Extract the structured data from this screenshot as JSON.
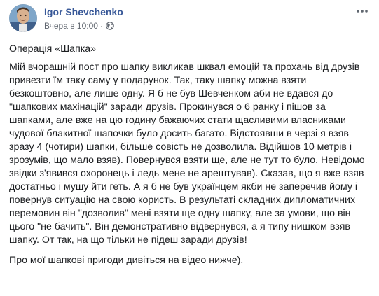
{
  "post": {
    "author": "Igor Shevchenko",
    "timestamp": "Вчера в 10:00",
    "separator": "·",
    "privacy_icon": "globe-icon",
    "more_icon": "more-options-icon",
    "title": "Операція «Шапка»",
    "body": "Мій вчорашній пост про шапку викликав шквал емоцій та прохань від друзів привезти їм таку саму у подарунок. Так, таку шапку можна взяти безкоштовно, але лише одну. Я б не був Шевченком аби не вдався до \"шапкових махінацій\" заради друзів. Прокинувся о 6 ранку і пішов за шапками, але вже на цю годину бажаючих стати щасливими власниками чудової блакитної шапочки було досить багато. Відстоявши в черзі я взяв зразу 4 (чотири) шапки, більше совість не дозволила. Відійшов 10 метрів і зрозумів, що мало взяв). Повернувся взяти ще, але не тут то було. Невідомо звідки з'явився охоронець і ледь мене не арештував). Сказав, що я вже взяв достатньо і мушу йти геть. А я б не був українцем якби не заперечив йому і повернув ситуацію на свою користь. В результаті складних дипломатичних перемовин він \"дозволив\" мені взяти ще одну шапку, але за умови, що він цього \"не бачить\". Він демонстративно відвернувся, а я типу нишком взяв шапку. От так, на що тільки не підеш заради друзів!",
    "footer": "Про мої шапкові пригоди дивіться на відео нижче)."
  },
  "colors": {
    "author_link": "#385898",
    "meta_text": "#616770",
    "body_text": "#1c1e21"
  }
}
